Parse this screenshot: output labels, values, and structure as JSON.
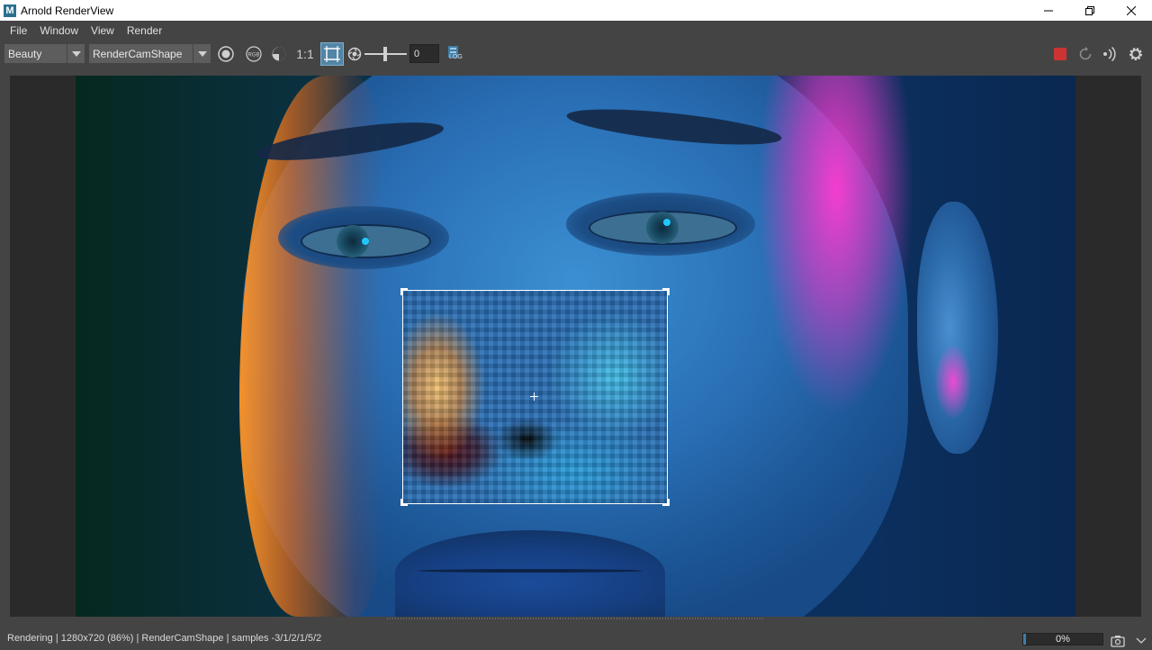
{
  "window": {
    "title": "Arnold RenderView",
    "icon_letter": "M",
    "controls": [
      "minimize-icon",
      "restore-icon",
      "close-icon"
    ]
  },
  "menu": [
    "File",
    "Window",
    "View",
    "Render"
  ],
  "toolbar": {
    "aov_value": "Beauty",
    "camera_value": "RenderCamShape",
    "ratio_label": "1:1",
    "exposure_value": "0",
    "log_label": "LOG",
    "icons": [
      "display-color-icon",
      "rgb-channels-icon",
      "alpha-contrast-icon",
      "region-crop-icon",
      "exposure-icon",
      "stop-render-icon",
      "refresh-icon",
      "ipr-icon",
      "settings-icon"
    ],
    "colors": {
      "active_button": "#5285a6",
      "stop_button": "#cc3333"
    }
  },
  "status": {
    "text": "Rendering | 1280x720 (86%) | RenderCamShape | samples -3/1/2/1/5/2",
    "progress_label": "0%",
    "progress_fraction": 0.03
  }
}
